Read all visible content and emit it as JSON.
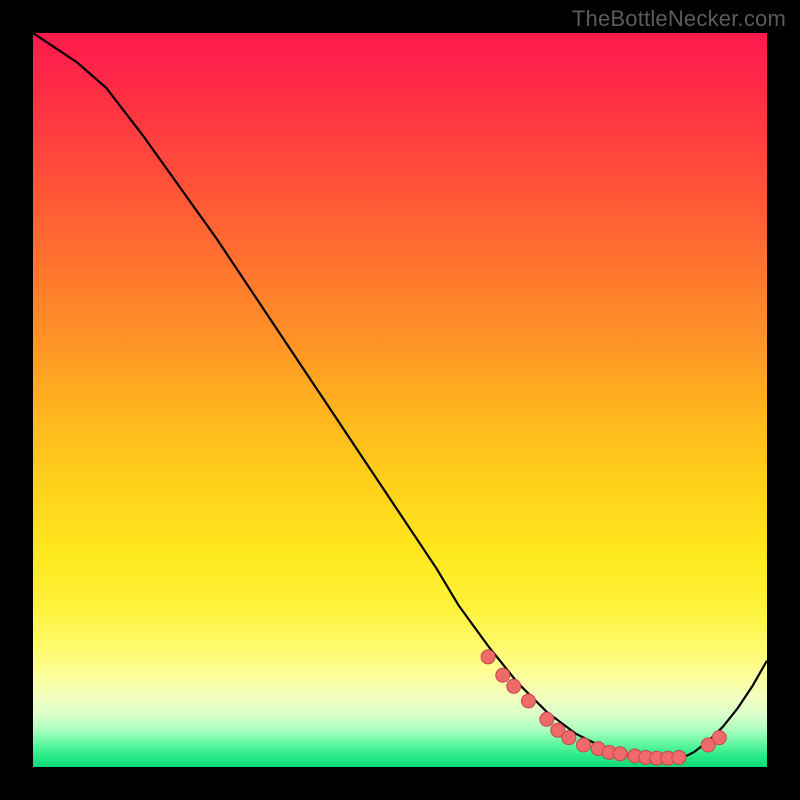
{
  "watermark": "TheBottleNecker.com",
  "colors": {
    "background": "#000000",
    "curve": "#000000",
    "scatter_fill": "#ef6a6a",
    "scatter_stroke": "#c94747",
    "gradient_stops": [
      {
        "offset": 0.0,
        "color": "#ff1a4d"
      },
      {
        "offset": 0.07,
        "color": "#ff2a46"
      },
      {
        "offset": 0.18,
        "color": "#ff4a3b"
      },
      {
        "offset": 0.3,
        "color": "#ff6e30"
      },
      {
        "offset": 0.42,
        "color": "#ff9426"
      },
      {
        "offset": 0.52,
        "color": "#ffb61e"
      },
      {
        "offset": 0.62,
        "color": "#ffd21a"
      },
      {
        "offset": 0.71,
        "color": "#ffe81e"
      },
      {
        "offset": 0.78,
        "color": "#fff23a"
      },
      {
        "offset": 0.835,
        "color": "#fffa6a"
      },
      {
        "offset": 0.875,
        "color": "#fdff9a"
      },
      {
        "offset": 0.905,
        "color": "#f2ffbf"
      },
      {
        "offset": 0.93,
        "color": "#d9ffcb"
      },
      {
        "offset": 0.95,
        "color": "#a9ffbf"
      },
      {
        "offset": 0.968,
        "color": "#63f7a0"
      },
      {
        "offset": 0.985,
        "color": "#28eb87"
      },
      {
        "offset": 1.0,
        "color": "#0fd877"
      }
    ]
  },
  "chart_data": {
    "type": "line",
    "title": "",
    "xlabel": "",
    "ylabel": "",
    "xlim": [
      0,
      100
    ],
    "ylim": [
      0,
      100
    ],
    "grid": false,
    "series": [
      {
        "name": "curve",
        "x": [
          0,
          3,
          6,
          10,
          15,
          20,
          25,
          30,
          35,
          40,
          45,
          50,
          55,
          58,
          62,
          66,
          70,
          74,
          78,
          82,
          86,
          88,
          90,
          92,
          94,
          96,
          98,
          100
        ],
        "y": [
          100,
          98,
          96,
          92.5,
          86,
          79,
          72,
          64.5,
          57,
          49.5,
          42,
          34.5,
          27,
          22,
          16.5,
          11.5,
          7.5,
          4.5,
          2.5,
          1.2,
          0.7,
          1.0,
          2.0,
          3.5,
          5.5,
          8.0,
          11.0,
          14.5
        ]
      }
    ],
    "scatter": {
      "name": "dots",
      "x": [
        62.0,
        64.0,
        65.5,
        67.5,
        70.0,
        71.5,
        73.0,
        75.0,
        77.0,
        78.5,
        80.0,
        82.0,
        83.5,
        85.0,
        86.5,
        88.0,
        92.0,
        93.5
      ],
      "y": [
        15.0,
        12.5,
        11.0,
        9.0,
        6.5,
        5.0,
        4.0,
        3.0,
        2.5,
        2.0,
        1.8,
        1.5,
        1.3,
        1.2,
        1.2,
        1.3,
        3.0,
        4.0
      ],
      "r": 7
    }
  }
}
